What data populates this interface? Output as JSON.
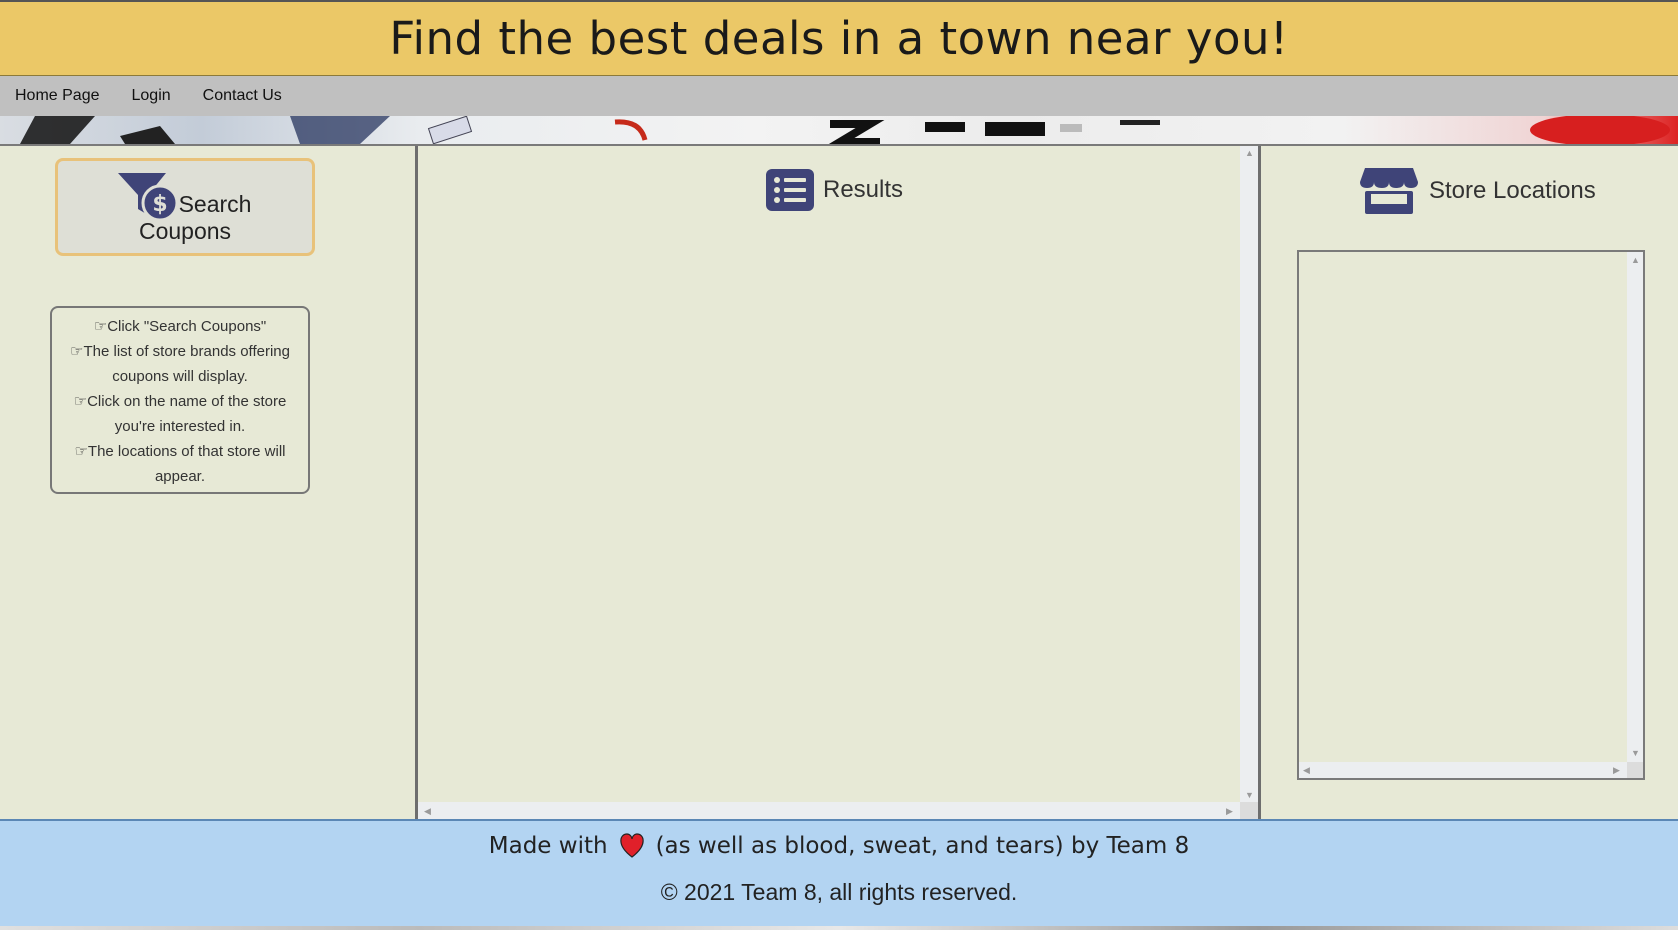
{
  "header": {
    "title": "Find the best deals in a town near you!"
  },
  "nav": {
    "items": [
      "Home Page",
      "Login",
      "Contact Us"
    ]
  },
  "search": {
    "label_line1": "Search",
    "label_line2": "Coupons"
  },
  "instructions": {
    "lines": [
      "Click \"Search Coupons\"",
      "The list of store brands offering coupons will display.",
      "Click on the name of the store you're interested in.",
      "The locations of that store will appear."
    ]
  },
  "results": {
    "title": "Results"
  },
  "locations": {
    "title": "Store Locations"
  },
  "footer": {
    "line1_before": "Made with",
    "line1_after": "(as well as blood, sweat, and tears) by Team 8",
    "line2": "© 2021 Team 8, all rights reserved."
  },
  "colors": {
    "banner": "#ebc867",
    "nav": "#c0c0c0",
    "panel": "#e7e9d6",
    "icon": "#3f4478",
    "footer": "#b3d4f2",
    "heart": "#e0202a"
  },
  "icons": [
    "funnel-dollar-icon",
    "list-icon",
    "store-icon",
    "heart-icon",
    "hand-point-right-icon"
  ]
}
